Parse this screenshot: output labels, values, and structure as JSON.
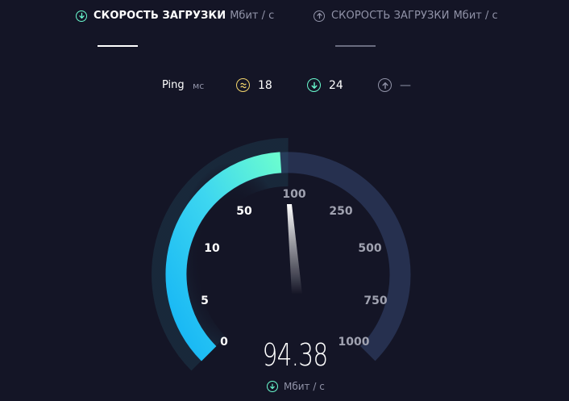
{
  "tabs": {
    "download": {
      "title": "СКОРОСТЬ ЗАГРУЗКИ",
      "unit": "Мбит / с"
    },
    "upload": {
      "title": "СКОРОСТЬ ЗАГРУЗКИ",
      "unit": "Мбит / с"
    }
  },
  "ping": {
    "label": "Ping",
    "unit": "мс",
    "jitter": "18",
    "download": "24",
    "upload": "—"
  },
  "gauge": {
    "ticks": {
      "t0": "0",
      "t5": "5",
      "t10": "10",
      "t50": "50",
      "t100": "100",
      "t250": "250",
      "t500": "500",
      "t750": "750",
      "t1000": "1000"
    },
    "needle_value": 94.38
  },
  "speed": {
    "value": "94.38",
    "unit": "Мбит / с"
  },
  "colors": {
    "background": "#141526",
    "accent_download": "#6afcd0",
    "accent_jitter": "#f3d56b",
    "gauge_track": "#26304f",
    "gauge_start": "#14b4f5"
  }
}
